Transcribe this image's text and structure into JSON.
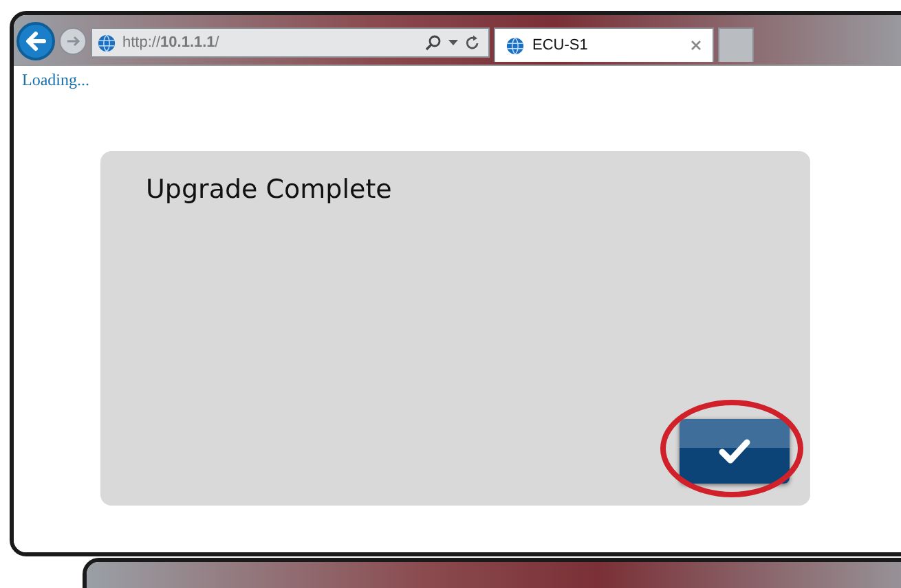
{
  "browser": {
    "address": "http://**10.1.1.1**/",
    "tab": {
      "title": "ECU-S1",
      "selected": true
    }
  },
  "page": {
    "status": "Loading...",
    "dialog": {
      "title": "Upgrade Complete",
      "confirm_button": {
        "highlighted": true
      }
    }
  }
}
